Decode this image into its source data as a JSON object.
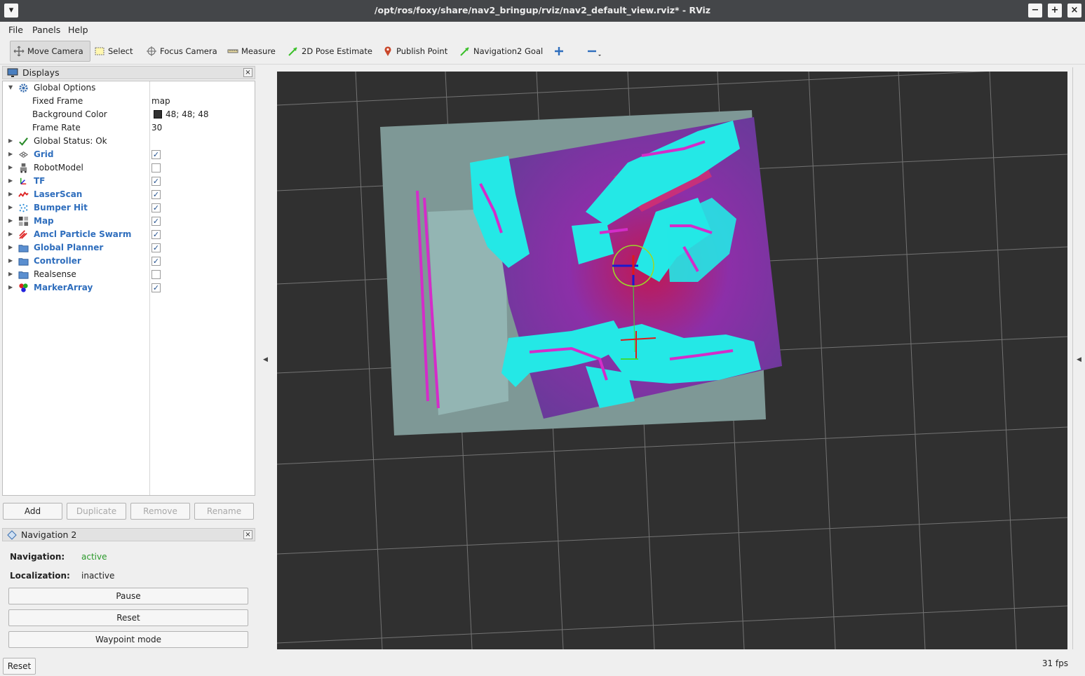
{
  "window": {
    "title": "/opt/ros/foxy/share/nav2_bringup/rviz/nav2_default_view.rviz* - RViz",
    "buttons": [
      "−",
      "+",
      "×"
    ]
  },
  "menu": [
    "File",
    "Panels",
    "Help"
  ],
  "toolbar": [
    {
      "label": "Move Camera",
      "icon": "move-camera-icon",
      "active": true
    },
    {
      "label": "Select",
      "icon": "select-icon"
    },
    {
      "label": "Focus Camera",
      "icon": "focus-camera-icon"
    },
    {
      "label": "Measure",
      "icon": "ruler-icon"
    },
    {
      "label": "2D Pose Estimate",
      "icon": "pose-estimate-arrow-icon"
    },
    {
      "label": "Publish Point",
      "icon": "map-pin-icon"
    },
    {
      "label": "Navigation2 Goal",
      "icon": "nav-goal-arrow-icon"
    },
    {
      "label": "",
      "icon": "plus-icon"
    },
    {
      "label": "",
      "icon": "minus-icon"
    }
  ],
  "displays": {
    "title": "Displays",
    "global_options": {
      "label": "Global Options",
      "fixed_frame_label": "Fixed Frame",
      "fixed_frame_value": "map",
      "background_color_label": "Background Color",
      "background_color_value": "48; 48; 48",
      "background_color_hex": "#303030",
      "frame_rate_label": "Frame Rate",
      "frame_rate_value": "30"
    },
    "global_status": "Global Status: Ok",
    "items": [
      {
        "label": "Grid",
        "checked": true,
        "icon": "grid-icon",
        "blue": true
      },
      {
        "label": "RobotModel",
        "checked": false,
        "icon": "robot-icon",
        "blue": false
      },
      {
        "label": "TF",
        "checked": true,
        "icon": "tf-axes-icon",
        "blue": true
      },
      {
        "label": "LaserScan",
        "checked": true,
        "icon": "laserscan-icon",
        "blue": true
      },
      {
        "label": "Bumper Hit",
        "checked": true,
        "icon": "pointcloud-icon",
        "blue": true
      },
      {
        "label": "Map",
        "checked": true,
        "icon": "map-icon",
        "blue": true
      },
      {
        "label": "Amcl Particle Swarm",
        "checked": true,
        "icon": "pose-array-icon",
        "blue": true
      },
      {
        "label": "Global Planner",
        "checked": true,
        "icon": "folder-icon",
        "blue": true
      },
      {
        "label": "Controller",
        "checked": true,
        "icon": "folder-icon",
        "blue": true
      },
      {
        "label": "Realsense",
        "checked": false,
        "icon": "folder-icon",
        "blue": false
      },
      {
        "label": "MarkerArray",
        "checked": true,
        "icon": "marker-icon",
        "blue": true
      }
    ],
    "buttons": {
      "add": "Add",
      "duplicate": "Duplicate",
      "remove": "Remove",
      "rename": "Rename"
    }
  },
  "nav2": {
    "title": "Navigation 2",
    "navigation_label": "Navigation:",
    "navigation_value": "active",
    "localization_label": "Localization:",
    "localization_value": "inactive",
    "pause": "Pause",
    "reset": "Reset",
    "waypoint": "Waypoint mode"
  },
  "status": {
    "reset": "Reset",
    "fps": "31 fps"
  },
  "colors": {
    "active_green": "#2a9a2a",
    "link_blue": "#2f6ebd",
    "viewport_bg": "#303030"
  }
}
